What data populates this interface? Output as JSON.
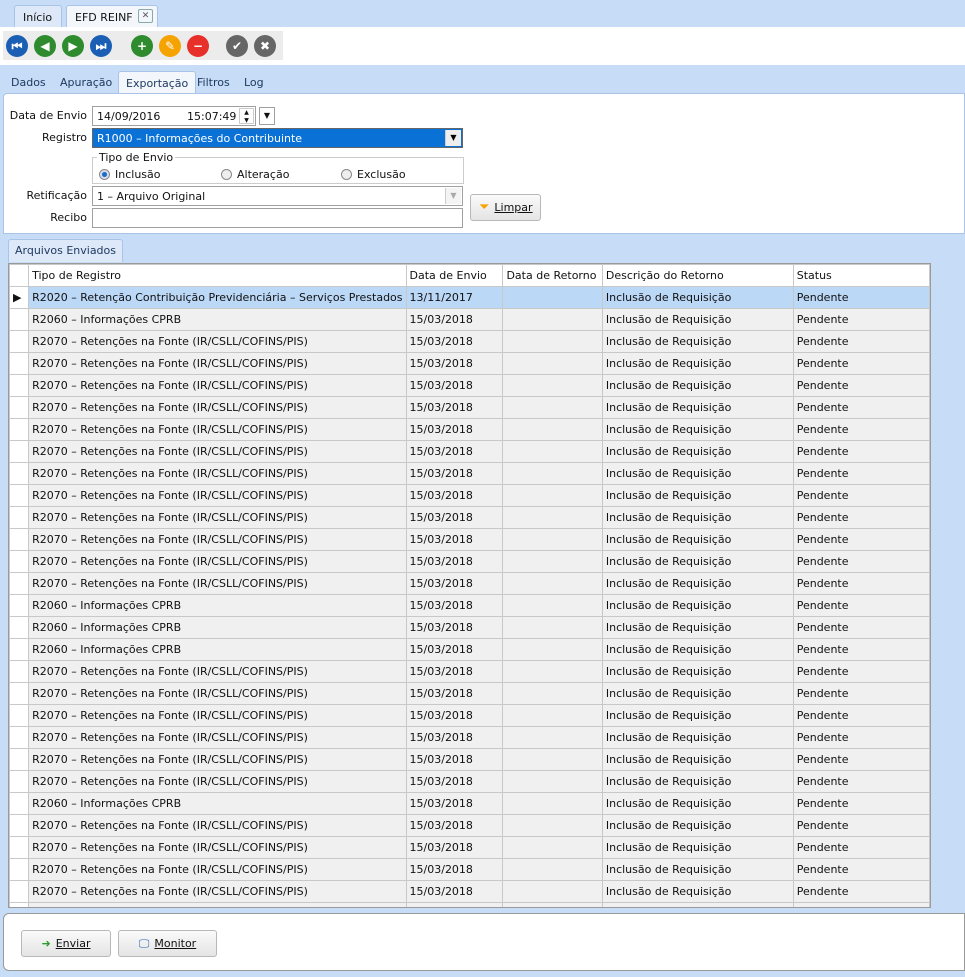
{
  "tabs": [
    {
      "label": "Início"
    },
    {
      "label": "EFD REINF"
    }
  ],
  "toolbar": [
    "first",
    "previous",
    "next",
    "last",
    "add",
    "edit",
    "delete",
    "confirm",
    "cancel"
  ],
  "subtabs": [
    "Dados",
    "Apuração",
    "Exportação",
    "Filtros",
    "Log"
  ],
  "form": {
    "data_envio_label": "Data de Envio",
    "data_envio_date": "14/09/2016",
    "data_envio_time": "15:07:49",
    "registro_label": "Registro",
    "registro_value": "R1000 – Informações do Contribuinte",
    "tipo_envio_label": "Tipo de Envio",
    "tipo_options": [
      "Inclusão",
      "Alteração",
      "Exclusão"
    ],
    "tipo_selected": "Inclusão",
    "retificacao_label": "Retificação",
    "retificacao_value": "1 – Arquivo Original",
    "recibo_label": "Recibo",
    "recibo_value": "",
    "limpar_label": "Limpar"
  },
  "grid": {
    "tab_label": "Arquivos Enviados",
    "columns": [
      "Tipo de Registro",
      "Data de Envio",
      "Data de Retorno",
      "Descrição do Retorno",
      "Status"
    ],
    "rows": [
      [
        "R2020 – Retenção Contribuição Previdenciária – Serviços Prestados",
        "13/11/2017",
        "",
        "Inclusão de Requisição",
        "Pendente"
      ],
      [
        "R2060 – Informações CPRB",
        "15/03/2018",
        "",
        "Inclusão de Requisição",
        "Pendente"
      ],
      [
        "R2070 – Retenções na Fonte (IR/CSLL/COFINS/PIS)",
        "15/03/2018",
        "",
        "Inclusão de Requisição",
        "Pendente"
      ],
      [
        "R2070 – Retenções na Fonte (IR/CSLL/COFINS/PIS)",
        "15/03/2018",
        "",
        "Inclusão de Requisição",
        "Pendente"
      ],
      [
        "R2070 – Retenções na Fonte (IR/CSLL/COFINS/PIS)",
        "15/03/2018",
        "",
        "Inclusão de Requisição",
        "Pendente"
      ],
      [
        "R2070 – Retenções na Fonte (IR/CSLL/COFINS/PIS)",
        "15/03/2018",
        "",
        "Inclusão de Requisição",
        "Pendente"
      ],
      [
        "R2070 – Retenções na Fonte (IR/CSLL/COFINS/PIS)",
        "15/03/2018",
        "",
        "Inclusão de Requisição",
        "Pendente"
      ],
      [
        "R2070 – Retenções na Fonte (IR/CSLL/COFINS/PIS)",
        "15/03/2018",
        "",
        "Inclusão de Requisição",
        "Pendente"
      ],
      [
        "R2070 – Retenções na Fonte (IR/CSLL/COFINS/PIS)",
        "15/03/2018",
        "",
        "Inclusão de Requisição",
        "Pendente"
      ],
      [
        "R2070 – Retenções na Fonte (IR/CSLL/COFINS/PIS)",
        "15/03/2018",
        "",
        "Inclusão de Requisição",
        "Pendente"
      ],
      [
        "R2070 – Retenções na Fonte (IR/CSLL/COFINS/PIS)",
        "15/03/2018",
        "",
        "Inclusão de Requisição",
        "Pendente"
      ],
      [
        "R2070 – Retenções na Fonte (IR/CSLL/COFINS/PIS)",
        "15/03/2018",
        "",
        "Inclusão de Requisição",
        "Pendente"
      ],
      [
        "R2070 – Retenções na Fonte (IR/CSLL/COFINS/PIS)",
        "15/03/2018",
        "",
        "Inclusão de Requisição",
        "Pendente"
      ],
      [
        "R2070 – Retenções na Fonte (IR/CSLL/COFINS/PIS)",
        "15/03/2018",
        "",
        "Inclusão de Requisição",
        "Pendente"
      ],
      [
        "R2060 – Informações CPRB",
        "15/03/2018",
        "",
        "Inclusão de Requisição",
        "Pendente"
      ],
      [
        "R2060 – Informações CPRB",
        "15/03/2018",
        "",
        "Inclusão de Requisição",
        "Pendente"
      ],
      [
        "R2060 – Informações CPRB",
        "15/03/2018",
        "",
        "Inclusão de Requisição",
        "Pendente"
      ],
      [
        "R2070 – Retenções na Fonte (IR/CSLL/COFINS/PIS)",
        "15/03/2018",
        "",
        "Inclusão de Requisição",
        "Pendente"
      ],
      [
        "R2070 – Retenções na Fonte (IR/CSLL/COFINS/PIS)",
        "15/03/2018",
        "",
        "Inclusão de Requisição",
        "Pendente"
      ],
      [
        "R2070 – Retenções na Fonte (IR/CSLL/COFINS/PIS)",
        "15/03/2018",
        "",
        "Inclusão de Requisição",
        "Pendente"
      ],
      [
        "R2070 – Retenções na Fonte (IR/CSLL/COFINS/PIS)",
        "15/03/2018",
        "",
        "Inclusão de Requisição",
        "Pendente"
      ],
      [
        "R2070 – Retenções na Fonte (IR/CSLL/COFINS/PIS)",
        "15/03/2018",
        "",
        "Inclusão de Requisição",
        "Pendente"
      ],
      [
        "R2070 – Retenções na Fonte (IR/CSLL/COFINS/PIS)",
        "15/03/2018",
        "",
        "Inclusão de Requisição",
        "Pendente"
      ],
      [
        "R2060 – Informações CPRB",
        "15/03/2018",
        "",
        "Inclusão de Requisição",
        "Pendente"
      ],
      [
        "R2070 – Retenções na Fonte (IR/CSLL/COFINS/PIS)",
        "15/03/2018",
        "",
        "Inclusão de Requisição",
        "Pendente"
      ],
      [
        "R2070 – Retenções na Fonte (IR/CSLL/COFINS/PIS)",
        "15/03/2018",
        "",
        "Inclusão de Requisição",
        "Pendente"
      ],
      [
        "R2070 – Retenções na Fonte (IR/CSLL/COFINS/PIS)",
        "15/03/2018",
        "",
        "Inclusão de Requisição",
        "Pendente"
      ],
      [
        "R2070 – Retenções na Fonte (IR/CSLL/COFINS/PIS)",
        "15/03/2018",
        "",
        "Inclusão de Requisição",
        "Pendente"
      ],
      [
        "R2070 – Retenções na Fonte (IR/CSLL/COFINS/PIS)",
        "15/03/2018",
        "",
        "Inclusão de Requisição",
        "Pendente"
      ]
    ]
  },
  "bottom": {
    "enviar_label": "Enviar",
    "monitor_label": "Monitor"
  }
}
